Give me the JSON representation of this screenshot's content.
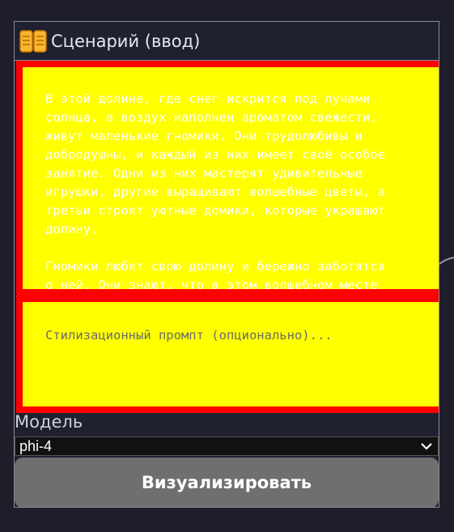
{
  "node": {
    "title": "Сценарий (ввод)",
    "icon": "book-icon"
  },
  "story": {
    "text": "В этой долине, где снег искрится под лучами\nсолнца, а воздух наполнен ароматом свежести,\nживут маленькие гномики. Они трудолюбивы и\nдобродушны, и каждый из них имеет своё особое\nзанятие. Одни из них мастерят удивительные\nигрушки, другие выращивают волшебные цветы, а\nтретьи строят уютные домики, которые украшают\nдолину.\n\nГномики любят свою долину и бережно заботятся\nо ней. Они знают, что в этом волшебном месте"
  },
  "style_prompt": {
    "placeholder": "Стилизационный промпт (опционально)..."
  },
  "model": {
    "label": "Модель",
    "selected": "phi-4"
  },
  "render_button": {
    "label": "Визуализировать"
  },
  "colors": {
    "background": "#1e1f2b",
    "field_fill": "#ffff00",
    "field_border": "#ff0000",
    "button": "#6f6f6f"
  }
}
